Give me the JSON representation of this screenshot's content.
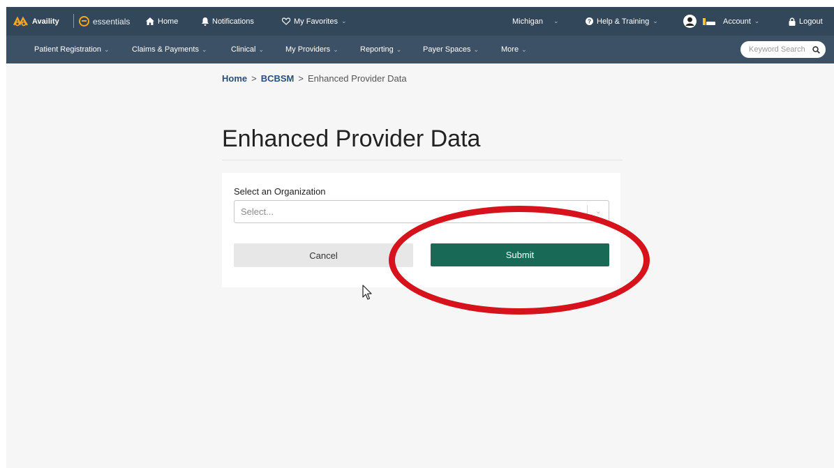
{
  "topbar": {
    "brand": "Availity",
    "essentials": "essentials",
    "home": "Home",
    "notifications": "Notifications",
    "favorites": "My Favorites",
    "state": "Michigan",
    "help": "Help & Training",
    "account": "Account",
    "logout": "Logout"
  },
  "nav": {
    "items": [
      {
        "label": "Patient Registration"
      },
      {
        "label": "Claims & Payments"
      },
      {
        "label": "Clinical"
      },
      {
        "label": "My Providers"
      },
      {
        "label": "Reporting"
      },
      {
        "label": "Payer Spaces"
      },
      {
        "label": "More"
      }
    ],
    "search_placeholder": "Keyword Search"
  },
  "breadcrumb": {
    "home": "Home",
    "payer": "BCBSM",
    "current": "Enhanced Provider Data",
    "separator": ">"
  },
  "page": {
    "title": "Enhanced Provider Data",
    "org_label": "Select an Organization",
    "org_placeholder": "Select...",
    "cancel": "Cancel",
    "submit": "Submit"
  },
  "colors": {
    "topbar_bg": "#33475b",
    "navbar_bg": "#3d5166",
    "submit_bg": "#186a57",
    "highlight": "#d6121c",
    "link": "#2b4f7a"
  },
  "icons": [
    "availity-logo-icon",
    "essentials-icon",
    "home-icon",
    "bell-icon",
    "heart-icon",
    "help-icon",
    "avatar-icon",
    "lock-icon",
    "search-icon",
    "chevron-down-icon",
    "cursor-icon"
  ]
}
